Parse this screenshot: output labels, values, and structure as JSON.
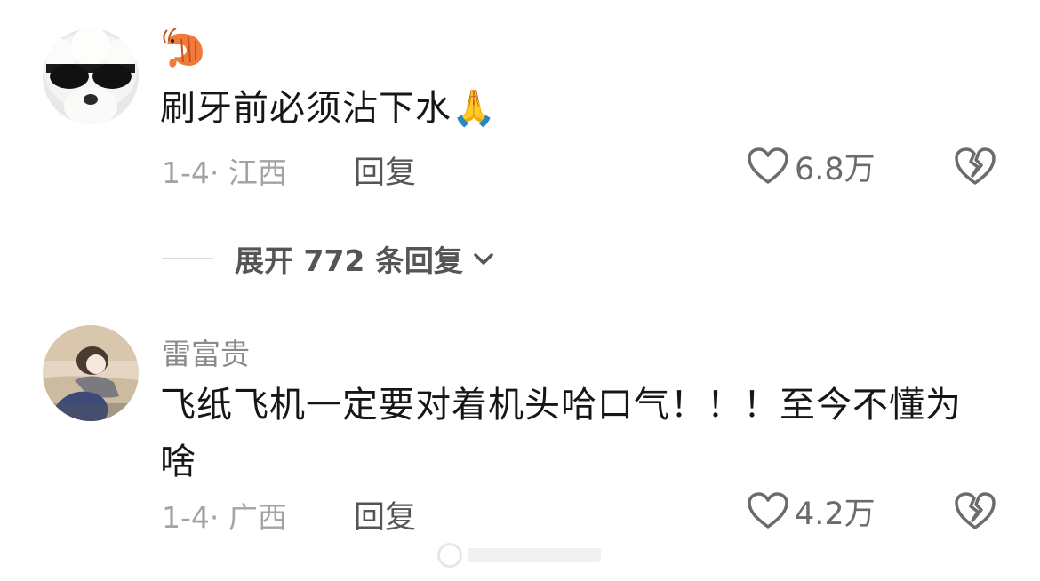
{
  "comments": [
    {
      "username": "",
      "username_icon": "shrimp-emoji",
      "text": "刷牙前必须沾下水🙏",
      "date": "1-4",
      "location": "江西",
      "reply_label": "回复",
      "likes": "6.8万",
      "avatar_icon": "dog-sunglasses-avatar"
    },
    {
      "username": "雷富贵",
      "text": "飞纸飞机一定要对着机头哈口气！！！至今不懂为啥",
      "date": "1-4",
      "location": "广西",
      "reply_label": "回复",
      "likes": "4.2万",
      "avatar_icon": "cartoon-girl-avatar"
    }
  ],
  "expand_replies": {
    "label": "展开 772 条回复",
    "icon": "chevron-down-icon"
  },
  "meta_separator": "·",
  "colors": {
    "text": "#161616",
    "meta": "#a3a3a3",
    "username": "#8a8a8a",
    "icon": "#6b6b6b"
  }
}
